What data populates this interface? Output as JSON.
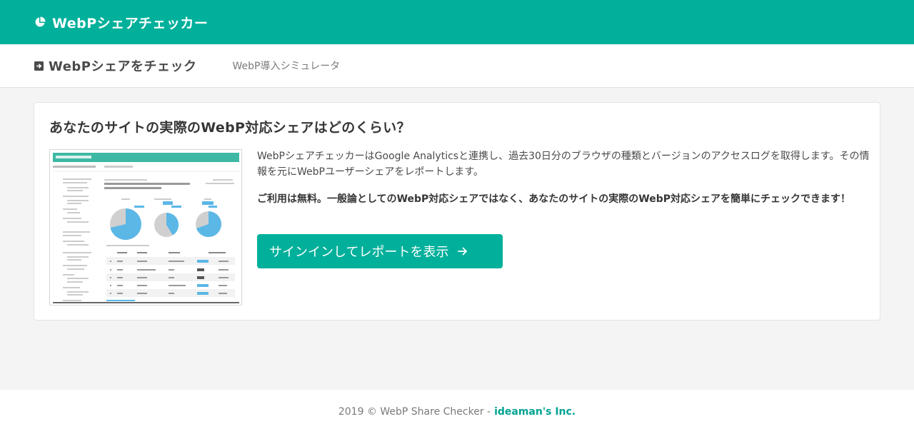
{
  "header": {
    "brand": "WebPシェアチェッカー",
    "logo_icon": "pie-chart-icon"
  },
  "nav": {
    "active_label": "WebPシェアをチェック",
    "active_icon": "arrow-right-square-icon",
    "link_label": "WebP導入シミュレータ"
  },
  "main": {
    "title": "あなたのサイトの実際のWebP対応シェアはどのくらい？",
    "description": "WebPシェアチェッカーはGoogle Analyticsと連携し、過去30日分のブラウザの種類とバージョンのアクセスログを取得します。その情報を元にWebPユーザーシェアをレポートします。",
    "description_bold": "ご利用は無料。一般論としてのWebP対応シェアではなく、あなたのサイトの実際のWebP対応シェアを簡単にチェックできます！",
    "cta_label": "サインインしてレポートを表示",
    "cta_icon": "arrow-right-icon",
    "preview_image": "report-screenshot-thumbnail"
  },
  "footer": {
    "copyright": "2019 © WebP Share Checker -",
    "company_link": "ideaman's Inc."
  },
  "colors": {
    "brand": "#00b09b",
    "link": "#00a393",
    "pie_primary": "#5bb7e6",
    "pie_secondary": "#d0d0d0"
  }
}
